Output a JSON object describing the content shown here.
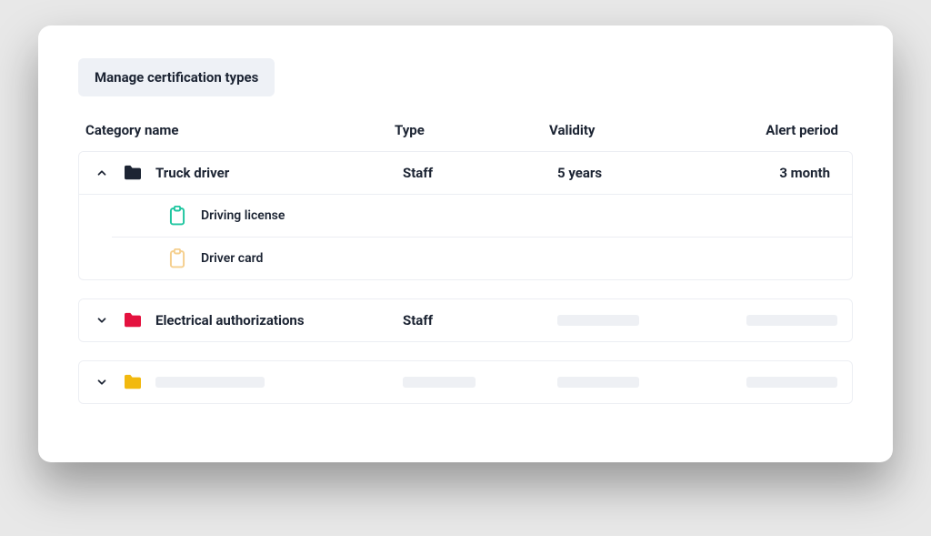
{
  "button_label": "Manage certification types",
  "columns": {
    "name": "Category name",
    "type": "Type",
    "validity": "Validity",
    "alert": "Alert period"
  },
  "rows": [
    {
      "expanded": true,
      "folder_color": "#1c2433",
      "name": "Truck driver",
      "type": "Staff",
      "validity": "5 years",
      "alert": "3 month",
      "children": [
        {
          "icon_color": "#1fc6a0",
          "label": "Driving license"
        },
        {
          "icon_color": "#f5cf8e",
          "label": "Driver card"
        }
      ]
    },
    {
      "expanded": false,
      "folder_color": "#e4123f",
      "name": "Electrical authorizations",
      "type": "Staff",
      "validity": "",
      "alert": ""
    },
    {
      "expanded": false,
      "folder_color": "#f2b90f",
      "name": "",
      "type": "",
      "validity": "",
      "alert": ""
    }
  ]
}
